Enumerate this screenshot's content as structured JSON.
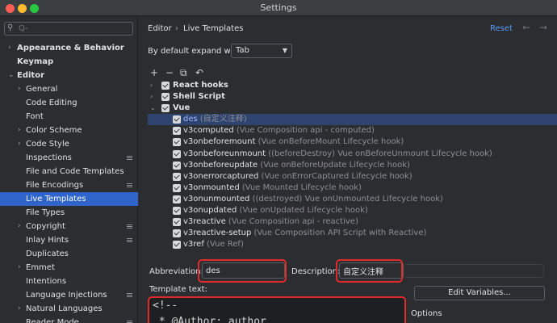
{
  "window": {
    "title": "Settings"
  },
  "sidebar": {
    "search_placeholder": "Q-",
    "items": [
      {
        "label": "Appearance & Behavior",
        "indent": 0,
        "bold": true,
        "arrow": "›",
        "pin": false
      },
      {
        "label": "Keymap",
        "indent": 0,
        "bold": true,
        "arrow": "",
        "pin": false
      },
      {
        "label": "Editor",
        "indent": 0,
        "bold": true,
        "arrow": "⌄",
        "pin": false
      },
      {
        "label": "General",
        "indent": 1,
        "bold": false,
        "arrow": "›",
        "pin": false
      },
      {
        "label": "Code Editing",
        "indent": 1,
        "bold": false,
        "arrow": "",
        "pin": false
      },
      {
        "label": "Font",
        "indent": 1,
        "bold": false,
        "arrow": "",
        "pin": false
      },
      {
        "label": "Color Scheme",
        "indent": 1,
        "bold": false,
        "arrow": "›",
        "pin": false
      },
      {
        "label": "Code Style",
        "indent": 1,
        "bold": false,
        "arrow": "›",
        "pin": false
      },
      {
        "label": "Inspections",
        "indent": 1,
        "bold": false,
        "arrow": "",
        "pin": true
      },
      {
        "label": "File and Code Templates",
        "indent": 1,
        "bold": false,
        "arrow": "",
        "pin": false
      },
      {
        "label": "File Encodings",
        "indent": 1,
        "bold": false,
        "arrow": "",
        "pin": true
      },
      {
        "label": "Live Templates",
        "indent": 1,
        "bold": false,
        "arrow": "",
        "pin": false,
        "selected": true
      },
      {
        "label": "File Types",
        "indent": 1,
        "bold": false,
        "arrow": "",
        "pin": false
      },
      {
        "label": "Copyright",
        "indent": 1,
        "bold": false,
        "arrow": "›",
        "pin": true
      },
      {
        "label": "Inlay Hints",
        "indent": 1,
        "bold": false,
        "arrow": "",
        "pin": true
      },
      {
        "label": "Duplicates",
        "indent": 1,
        "bold": false,
        "arrow": "",
        "pin": false
      },
      {
        "label": "Emmet",
        "indent": 1,
        "bold": false,
        "arrow": "›",
        "pin": false
      },
      {
        "label": "Intentions",
        "indent": 1,
        "bold": false,
        "arrow": "",
        "pin": false
      },
      {
        "label": "Language Injections",
        "indent": 1,
        "bold": false,
        "arrow": "",
        "pin": true
      },
      {
        "label": "Natural Languages",
        "indent": 1,
        "bold": false,
        "arrow": "›",
        "pin": false
      },
      {
        "label": "Reader Mode",
        "indent": 1,
        "bold": false,
        "arrow": "",
        "pin": true
      }
    ]
  },
  "main": {
    "breadcrumb": [
      "Editor",
      "Live Templates"
    ],
    "breadcrumb_sep": "›",
    "reset_label": "Reset",
    "nav_back": "←",
    "nav_forward": "→",
    "expand_label": "By default expand with",
    "expand_value": "Tab",
    "toolbar": [
      "+",
      "−",
      "⧉",
      "↶"
    ],
    "groups": [
      {
        "name": "React hooks",
        "expanded": false
      },
      {
        "name": "Shell Script",
        "expanded": false
      },
      {
        "name": "Vue",
        "expanded": true
      }
    ],
    "templates": [
      {
        "name": "des",
        "desc": "(自定义注释)",
        "selected": true
      },
      {
        "name": "v3computed",
        "desc": "(Vue Composition api - computed)"
      },
      {
        "name": "v3onbeforemount",
        "desc": "(Vue onBeforeMount Lifecycle hook)"
      },
      {
        "name": "v3onbeforeunmount",
        "desc": "((beforeDestroy) Vue onBeforeUnmount Lifecycle hook)"
      },
      {
        "name": "v3onbeforeupdate",
        "desc": "(Vue onBeforeUpdate Lifecycle hook)"
      },
      {
        "name": "v3onerrorcaptured",
        "desc": "(Vue onErrorCaptured Lifecycle hook)"
      },
      {
        "name": "v3onmounted",
        "desc": "(Vue Mounted Lifecycle hook)"
      },
      {
        "name": "v3onunmounted",
        "desc": "((destroyed) Vue onUnmounted Lifecycle hook)"
      },
      {
        "name": "v3onupdated",
        "desc": "(Vue onUpdated Lifecycle hook)"
      },
      {
        "name": "v3reactive",
        "desc": "(Vue Composition api - reactive)"
      },
      {
        "name": "v3reactive-setup",
        "desc": "(Vue Composition API Script with Reactive)"
      },
      {
        "name": "v3ref",
        "desc": "(Vue Ref)"
      }
    ],
    "abbreviation_label": "Abbreviation:",
    "abbreviation_value": "des",
    "description_label": "Description:",
    "description_value": "自定义注释",
    "template_text_label": "Template text:",
    "template_text_lines": [
      "<!--",
      " * @Author: author"
    ],
    "edit_variables_label": "Edit Variables...",
    "options_label": "Options"
  },
  "colors": {
    "accent": "#2f65ca",
    "highlight": "#e12b2b",
    "link": "#589df6"
  }
}
